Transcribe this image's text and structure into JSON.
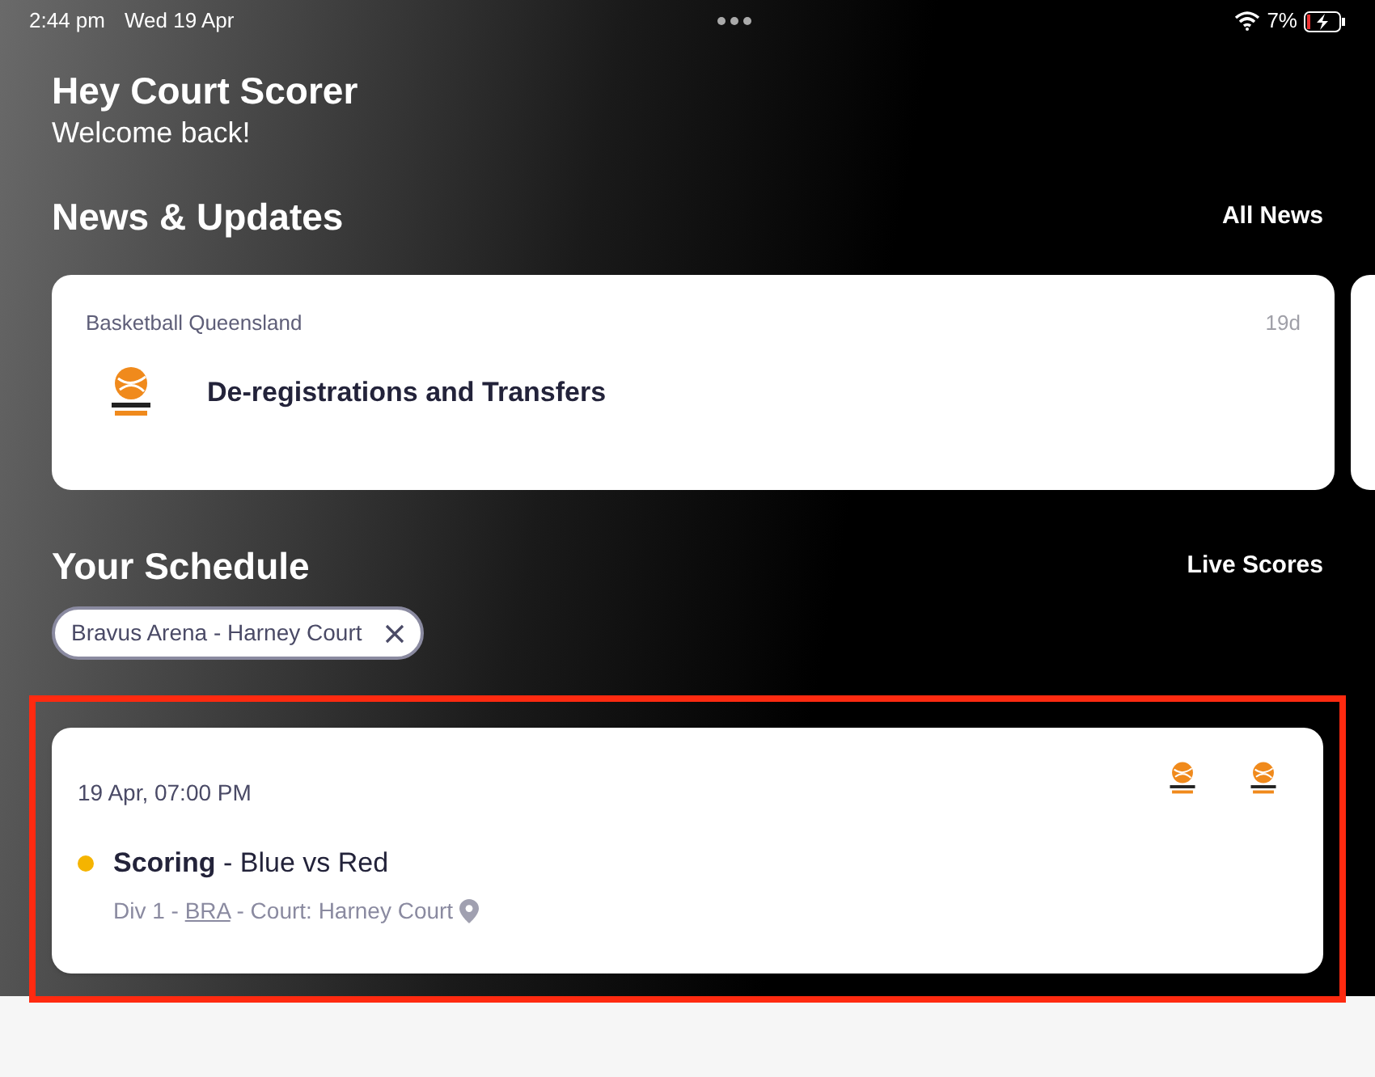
{
  "status_bar": {
    "time": "2:44 pm",
    "date": "Wed 19 Apr",
    "battery": "7%",
    "charging": true
  },
  "greeting": {
    "title": "Hey Court Scorer",
    "subtitle": "Welcome back!"
  },
  "news": {
    "title": "News & Updates",
    "link": "All News",
    "items": [
      {
        "source": "Basketball Queensland",
        "age": "19d",
        "headline": "De-registrations and Transfers"
      }
    ]
  },
  "schedule": {
    "title": "Your Schedule",
    "link": "Live Scores",
    "filters": [
      {
        "label": "Bravus Arena - Harney Court"
      }
    ],
    "games": [
      {
        "datetime": "19 Apr, 07:00 PM",
        "color": "#f5b400",
        "title": "**Scoring** - Blue vs Red",
        "details_before": "Div 1 -",
        "venue_link": "BRA",
        "details_after": "- Court: Harney Court",
        "highlighted": true
      }
    ]
  }
}
